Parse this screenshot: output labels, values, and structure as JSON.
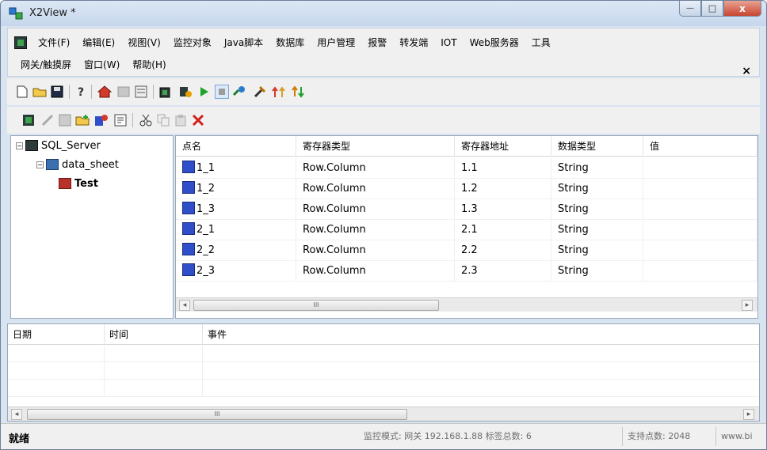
{
  "window": {
    "title": "X2View *"
  },
  "menu": {
    "items": [
      "文件(F)",
      "编辑(E)",
      "视图(V)",
      "监控对象",
      "Java脚本",
      "数据库",
      "用户管理",
      "报警",
      "转发端",
      "IOT",
      "Web服务器",
      "工具"
    ],
    "row2": [
      "网关/触摸屏",
      "窗口(W)",
      "帮助(H)"
    ],
    "mdi_close": "×"
  },
  "tree": {
    "root": "SQL_Server",
    "child": "data_sheet",
    "leaf": "Test"
  },
  "grid": {
    "headers": [
      "点名",
      "寄存器类型",
      "寄存器地址",
      "数据类型",
      "值"
    ],
    "rows": [
      [
        "1_1",
        "Row.Column",
        "1.1",
        "String",
        ""
      ],
      [
        "1_2",
        "Row.Column",
        "1.2",
        "String",
        ""
      ],
      [
        "1_3",
        "Row.Column",
        "1.3",
        "String",
        ""
      ],
      [
        "2_1",
        "Row.Column",
        "2.1",
        "String",
        ""
      ],
      [
        "2_2",
        "Row.Column",
        "2.2",
        "String",
        ""
      ],
      [
        "2_3",
        "Row.Column",
        "2.3",
        "String",
        ""
      ]
    ],
    "scroll_left": "◂",
    "scroll_right": "▸",
    "scroll_thumb": "III"
  },
  "log": {
    "headers": [
      "日期",
      "时间",
      "事件"
    ],
    "scroll_left": "◂",
    "scroll_right": "▸",
    "scroll_thumb": "III"
  },
  "status": {
    "ready": "就绪",
    "mode": "监控模式: 网关 192.168.1.88 标签总数: 6",
    "points": "支持点数: 2048",
    "site": "www.bi"
  },
  "icons": {
    "close_glyph": "x",
    "minimize_glyph": "—",
    "maximize_glyph": "□"
  }
}
